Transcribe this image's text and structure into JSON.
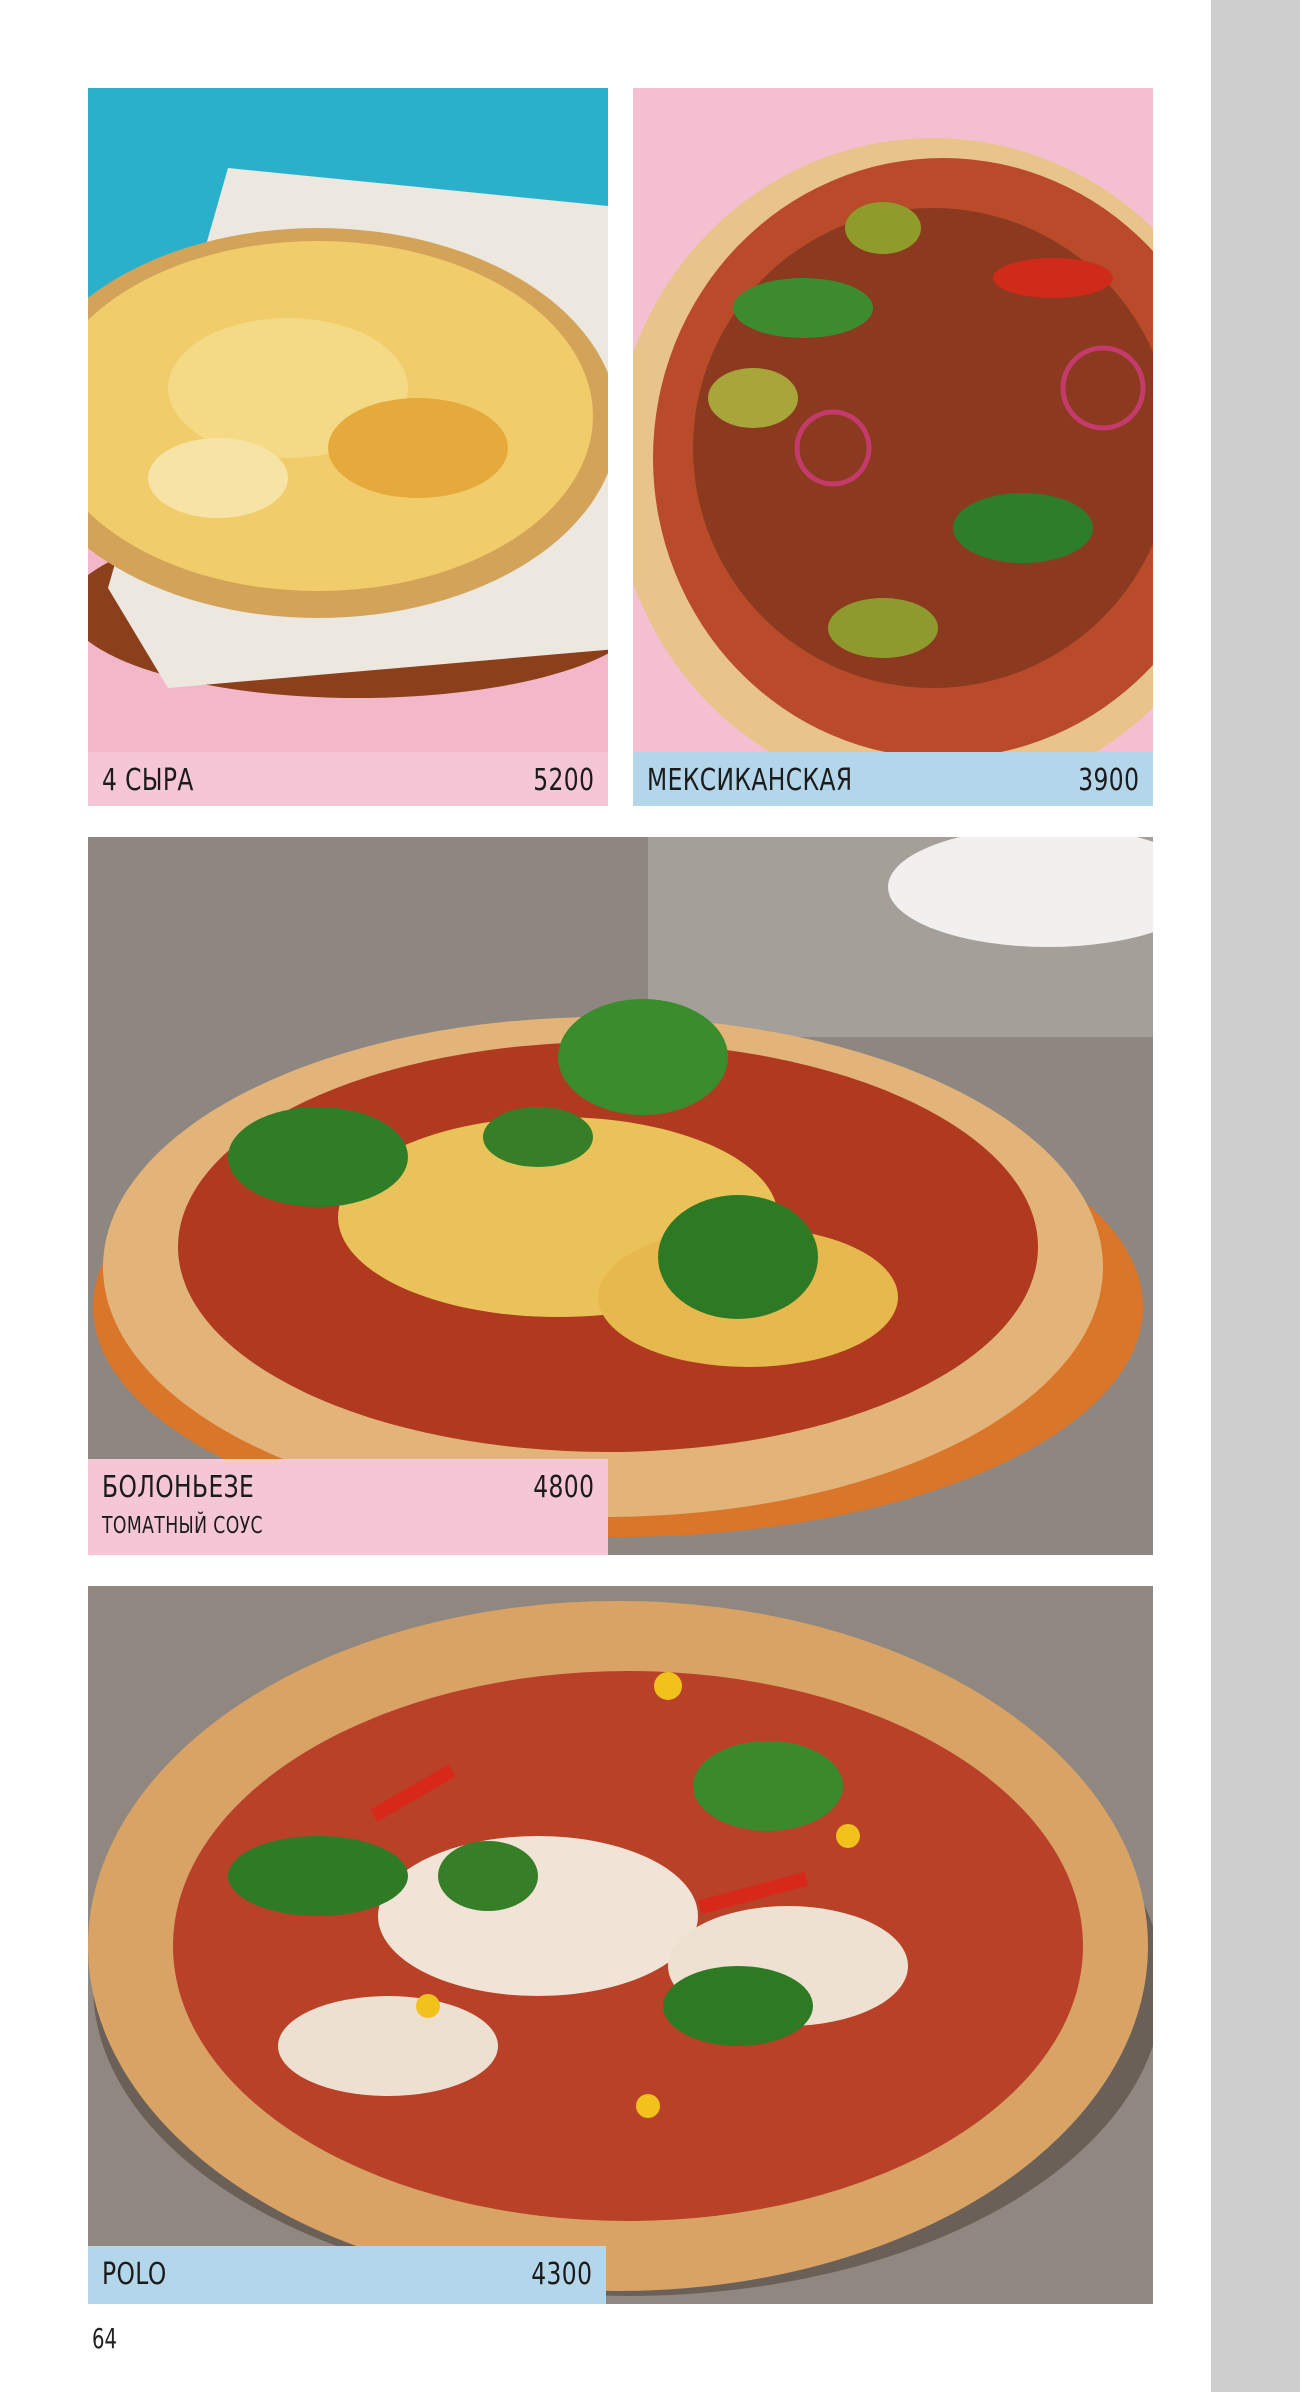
{
  "colors": {
    "pink_label": "#f5c6d6",
    "blue_label": "#b4d6ea",
    "sidebar_gray": "#cfcfcf"
  },
  "items": [
    {
      "name": "4 СЫРА",
      "price": "5200",
      "label_color": "pink"
    },
    {
      "name": "МЕКСИКАНСКАЯ",
      "price": "3900",
      "label_color": "blue"
    },
    {
      "name": "БОЛОНЬЕЗЕ",
      "subtitle": "ТОМАТНЫЙ СОУС",
      "price": "4800",
      "label_color": "pink"
    },
    {
      "name": "POLO",
      "price": "4300",
      "label_color": "blue"
    }
  ],
  "page_number": "64"
}
